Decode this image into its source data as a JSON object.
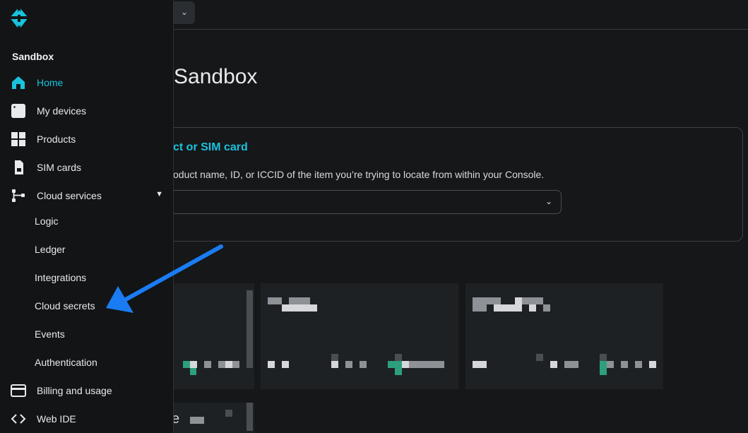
{
  "sidebar": {
    "title": "Sandbox",
    "items": [
      {
        "label": "Home",
        "icon": "home-icon",
        "active": true
      },
      {
        "label": "My devices",
        "icon": "device-icon"
      },
      {
        "label": "Products",
        "icon": "grid-icon"
      },
      {
        "label": "SIM cards",
        "icon": "sim-card-icon"
      },
      {
        "label": "Cloud services",
        "icon": "cloud-services-icon"
      }
    ],
    "cloud_services_items": [
      {
        "label": "Logic"
      },
      {
        "label": "Ledger"
      },
      {
        "label": "Integrations"
      },
      {
        "label": "Cloud secrets"
      },
      {
        "label": "Events"
      },
      {
        "label": "Authentication"
      }
    ],
    "bottom_items": [
      {
        "label": "Billing and usage",
        "icon": "credit-card-icon"
      },
      {
        "label": "Web IDE",
        "icon": "code-icon"
      }
    ]
  },
  "main": {
    "title": "Sandbox",
    "find_card": {
      "title": "ct or SIM card",
      "description": "oduct name, ID, or ICCID of the item you’re trying to locate from within your Console."
    },
    "partial_bottom_text": "e"
  },
  "colors": {
    "accent": "#19c3dd",
    "arrow": "#1a7cf2",
    "background": "#151719",
    "sidebar": "#121416"
  }
}
